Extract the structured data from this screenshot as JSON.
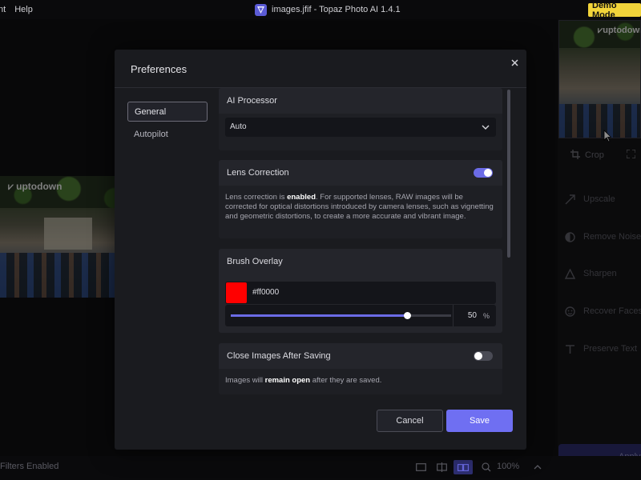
{
  "titlebar": {
    "menu_cut": "nt",
    "menu_help": "Help",
    "window_title": "images.jfif - Topaz Photo AI 1.4.1",
    "demo_badge": "Demo Mode"
  },
  "workspace": {
    "watermark": "uptodown"
  },
  "right_panel": {
    "crop_label": "Crop",
    "items": [
      {
        "label": "Upscale",
        "icon": "upscale-icon"
      },
      {
        "label": "Remove Noise",
        "icon": "remove-noise-icon"
      },
      {
        "label": "Sharpen",
        "icon": "sharpen-icon"
      },
      {
        "label": "Recover Faces",
        "icon": "recover-faces-icon"
      },
      {
        "label": "Preserve Text",
        "icon": "preserve-text-icon"
      }
    ],
    "apply_label": "Apply"
  },
  "bottombar": {
    "filters_text": "Filters Enabled",
    "zoom": "100%"
  },
  "dialog": {
    "title": "Preferences",
    "nav": {
      "general": "General",
      "autopilot": "Autopilot"
    },
    "ai_processor": {
      "title": "AI Processor",
      "selected": "Auto"
    },
    "lens_correction": {
      "title": "Lens Correction",
      "enabled": true,
      "desc_pre": "Lens correction is ",
      "desc_bold": "enabled",
      "desc_post": ". For supported lenses, RAW images will be corrected for optical distortions introduced by camera lenses, such as vignetting and geometric distortions, to create a more accurate and vibrant image."
    },
    "brush_overlay": {
      "title": "Brush Overlay",
      "color": "#ff0000",
      "hex_text": "#ff0000",
      "opacity_value": "50",
      "opacity_fraction": 0.5,
      "percent_sign": "%"
    },
    "close_after_saving": {
      "title": "Close Images After Saving",
      "enabled": false,
      "desc_pre": "Images will ",
      "desc_bold": "remain open",
      "desc_post": " after they are saved."
    },
    "cancel_label": "Cancel",
    "save_label": "Save"
  },
  "colors": {
    "accent": "#6f6ff2",
    "demo_badge": "#f2d43a",
    "dialog_bg": "#1a1b1f"
  }
}
